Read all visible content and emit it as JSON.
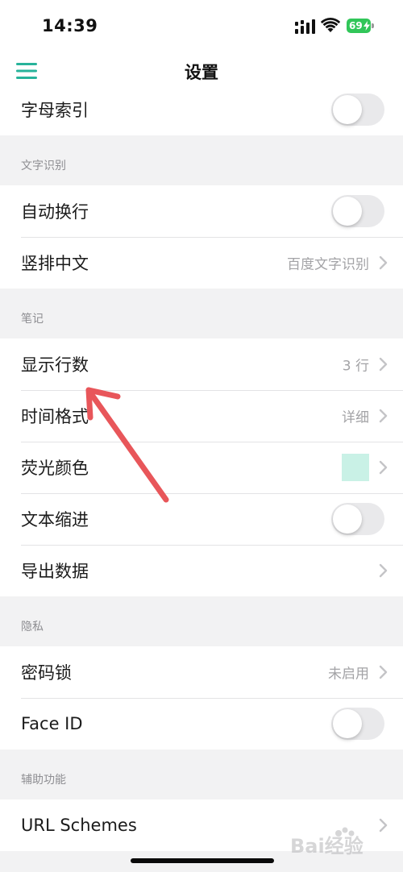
{
  "status_bar": {
    "time": "14:39",
    "battery_level": "69",
    "battery_color": "#31c659",
    "icons": [
      "signal-icon",
      "wifi-icon",
      "battery-icon"
    ]
  },
  "nav": {
    "title": "设置",
    "menu_icon": "hamburger-menu-icon",
    "accent_color": "#27b39a"
  },
  "top_partial": {
    "label": "字母索引",
    "toggle_on": false
  },
  "text_recognition": {
    "header": "文字识别",
    "items": [
      {
        "label": "自动换行",
        "type": "toggle",
        "toggle_on": false
      },
      {
        "label": "竖排中文",
        "type": "link",
        "value": "百度文字识别"
      }
    ]
  },
  "notes": {
    "header": "笔记",
    "items": [
      {
        "label": "显示行数",
        "type": "link",
        "value": "3 行"
      },
      {
        "label": "时间格式",
        "type": "link",
        "value": "详细"
      },
      {
        "label": "荧光颜色",
        "type": "color",
        "color": "#c9f1e6"
      },
      {
        "label": "文本缩进",
        "type": "toggle",
        "toggle_on": false
      },
      {
        "label": "导出数据",
        "type": "link",
        "value": ""
      }
    ]
  },
  "privacy": {
    "header": "隐私",
    "items": [
      {
        "label": "密码锁",
        "type": "link",
        "value": "未启用"
      },
      {
        "label": "Face ID",
        "type": "toggle",
        "toggle_on": false
      }
    ]
  },
  "accessibility": {
    "header": "辅助功能",
    "items": [
      {
        "label": "URL Schemes",
        "type": "link",
        "value": ""
      }
    ]
  },
  "annotation": {
    "arrow_color": "#e8565a"
  },
  "watermark": {
    "text": "Bai经验"
  }
}
